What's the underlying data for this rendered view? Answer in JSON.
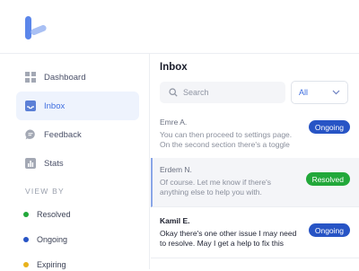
{
  "colors": {
    "accent": "#3f6ee0",
    "ongoing": "#2754c5",
    "resolved": "#22a83a",
    "expiring": "#e8b21c"
  },
  "sidebar": {
    "items": [
      {
        "label": "Dashboard",
        "icon": "grid-icon"
      },
      {
        "label": "Inbox",
        "icon": "inbox-icon",
        "active": true
      },
      {
        "label": "Feedback",
        "icon": "chat-bubble-icon"
      },
      {
        "label": "Stats",
        "icon": "bar-chart-icon"
      }
    ],
    "view_by_title": "VIEW BY",
    "filters": [
      {
        "label": "Resolved",
        "color": "#22a83a"
      },
      {
        "label": "Ongoing",
        "color": "#2754c5"
      },
      {
        "label": "Expiring",
        "color": "#e8b21c"
      }
    ]
  },
  "main": {
    "title": "Inbox",
    "search": {
      "placeholder": "Search"
    },
    "filter_select": {
      "value": "All"
    },
    "messages": [
      {
        "sender": "Emre A.",
        "preview": "You can then proceed to settings page. On the second section there's a toggle to...",
        "status": "Ongoing"
      },
      {
        "sender": "Erdem N.",
        "preview": "Of course. Let me know if there's anything else to help you with.",
        "status": "Resolved"
      },
      {
        "sender": "Kamil E.",
        "preview": "Okay there's one other issue I may need to resolve. May I get a help to fix this when...",
        "status": "Ongoing"
      }
    ]
  }
}
